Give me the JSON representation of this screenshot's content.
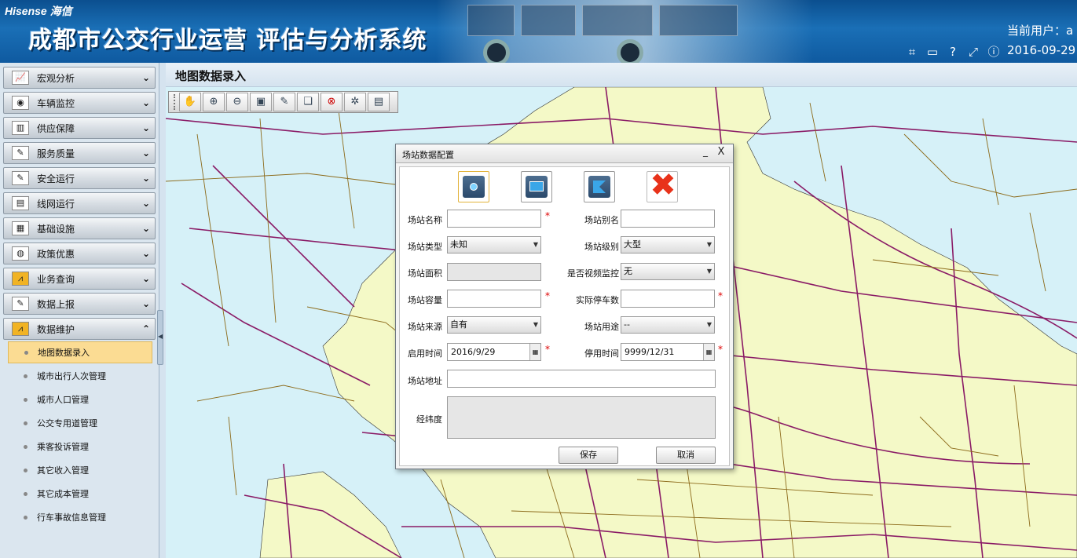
{
  "header": {
    "logo": "Hisense 海信",
    "app_title": "成都市公交行业运营 评估与分析系统",
    "user_label": "当前用户：a",
    "date": "2016-09-29",
    "icons": [
      "crop-icon",
      "keyboard-icon",
      "help-icon",
      "fullscreen-icon",
      "info-icon"
    ]
  },
  "sidebar": {
    "menus": [
      {
        "label": "宏观分析",
        "icon": "chart-line-icon"
      },
      {
        "label": "车辆监控",
        "icon": "camera-icon"
      },
      {
        "label": "供应保障",
        "icon": "supply-icon"
      },
      {
        "label": "服务质量",
        "icon": "edit-icon"
      },
      {
        "label": "安全运行",
        "icon": "edit-icon"
      },
      {
        "label": "线网运行",
        "icon": "bus-icon"
      },
      {
        "label": "基础设施",
        "icon": "infrastructure-icon"
      },
      {
        "label": "政策优惠",
        "icon": "policy-icon"
      },
      {
        "label": "业务查询",
        "icon": "chart-icon"
      },
      {
        "label": "数据上报",
        "icon": "edit-icon"
      },
      {
        "label": "数据维护",
        "icon": "chart-icon"
      }
    ],
    "submenu": [
      "地图数据录入",
      "城市出行人次管理",
      "城市人口管理",
      "公交专用道管理",
      "乘客投诉管理",
      "其它收入管理",
      "其它成本管理",
      "行车事故信息管理"
    ]
  },
  "main": {
    "title": "地图数据录入",
    "toolbar": [
      "pan-hand-icon",
      "zoom-in-icon",
      "zoom-out-icon",
      "full-extent-icon",
      "edit-icon",
      "layers-icon",
      "delete-icon",
      "clear-icon",
      "table-icon"
    ]
  },
  "dialog": {
    "title": "场站数据配置",
    "min": "_",
    "close": "X",
    "fields": {
      "name_label": "场站名称",
      "name_value": "",
      "alias_label": "场站别名",
      "alias_value": "",
      "type_label": "场站类型",
      "type_value": "未知",
      "level_label": "场站级别",
      "level_value": "大型",
      "area_label": "场站面积",
      "area_value": "",
      "video_label": "是否视频监控",
      "video_value": "无",
      "capacity_label": "场站容量",
      "capacity_value": "",
      "parking_label": "实际停车数",
      "parking_value": "",
      "source_label": "场站来源",
      "source_value": "自有",
      "usage_label": "场站用途",
      "usage_value": "--",
      "start_label": "启用时间",
      "start_value": "2016/9/29",
      "stop_label": "停用时间",
      "stop_value": "9999/12/31",
      "address_label": "场站地址",
      "address_value": "",
      "coords_label": "经纬度",
      "coords_value": ""
    },
    "required_mark": "*",
    "save_label": "保存",
    "cancel_label": "取消"
  },
  "colors": {
    "header": "#1a6fb6",
    "map_water": "#d6f1f8",
    "map_land": "#f4f9c7",
    "road_main": "#8a1b66",
    "road_minor": "#8c6a1a"
  }
}
